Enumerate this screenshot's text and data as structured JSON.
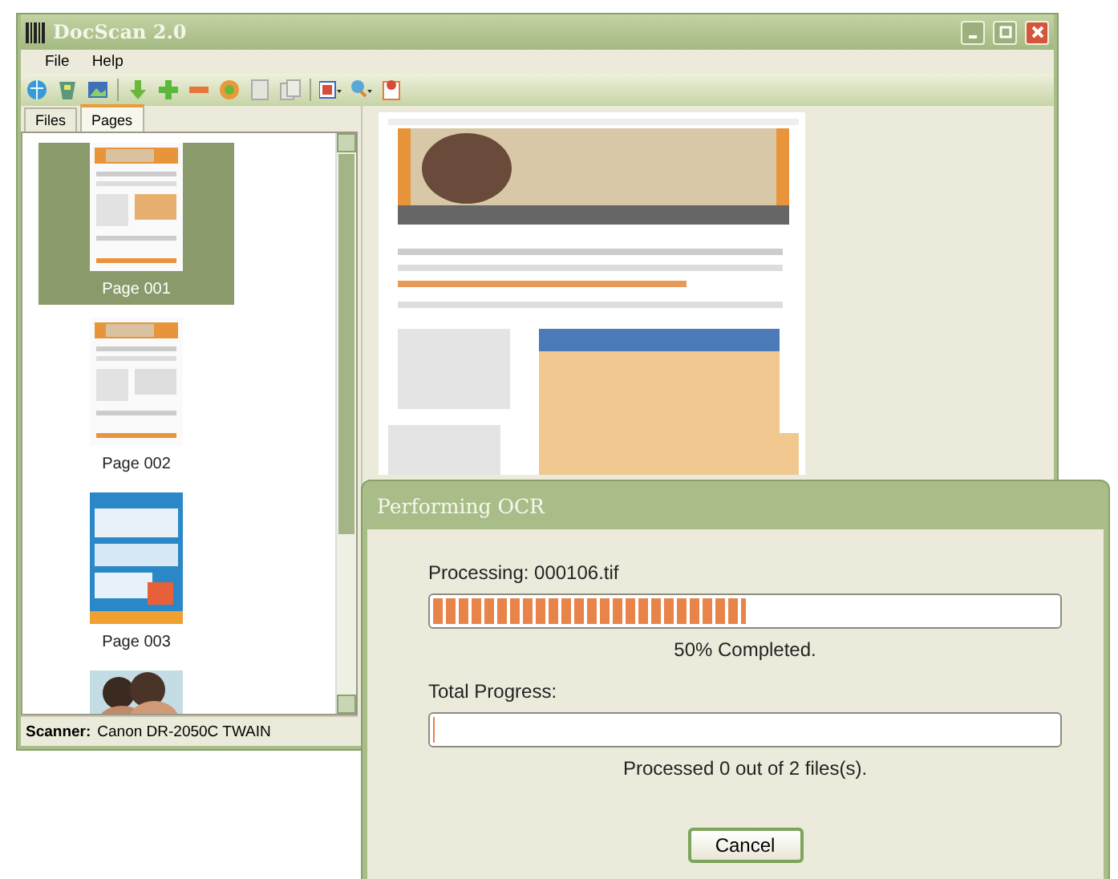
{
  "window": {
    "title": "DocScan 2.0"
  },
  "menu": [
    "File",
    "Help"
  ],
  "tabs": [
    {
      "label": "Files",
      "selected": false
    },
    {
      "label": "Pages",
      "selected": true
    }
  ],
  "pages": [
    {
      "label": "Page 001",
      "selected": true
    },
    {
      "label": "Page 002",
      "selected": false
    },
    {
      "label": "Page 003",
      "selected": false
    },
    {
      "selected": false
    }
  ],
  "status_bar": {
    "label": "Scanner:",
    "value": "Canon DR-2050C TWAIN"
  },
  "dialog": {
    "title": "Performing OCR",
    "processing_label": "Processing: 000106.tif",
    "file_progress": {
      "level": 0.5
    },
    "file_status": "50% Completed.",
    "total_label": "Total Progress:",
    "total_progress": {
      "level": 0
    },
    "total_status": "Processed 0 out of 2 files(s).",
    "cancel_button": "Cancel"
  }
}
